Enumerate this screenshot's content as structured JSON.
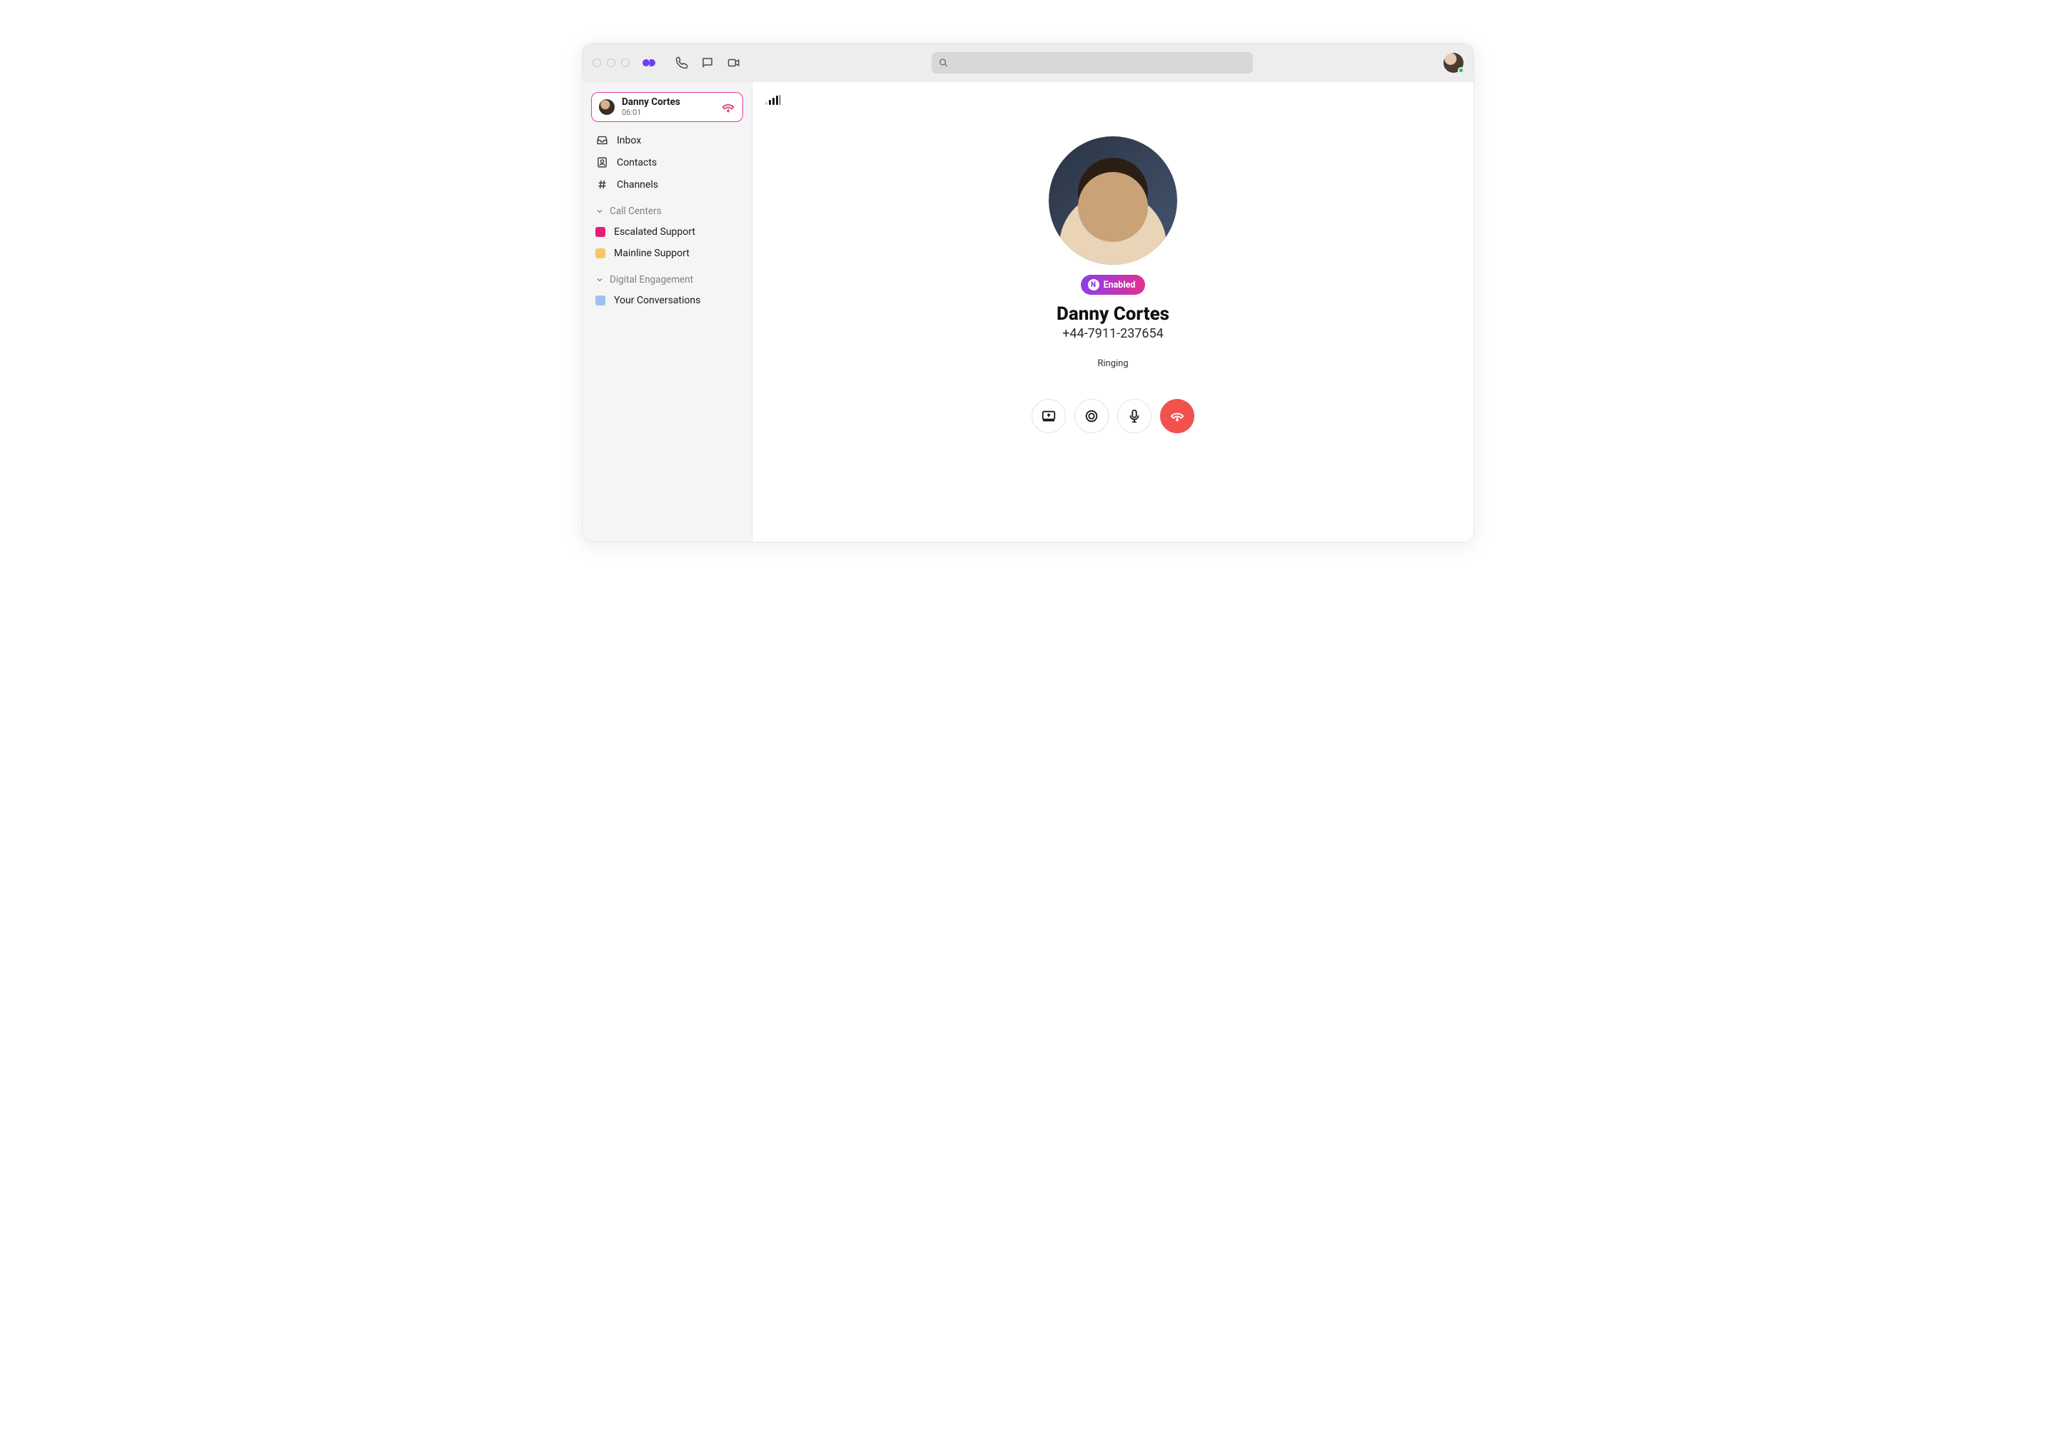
{
  "search": {
    "placeholder": ""
  },
  "active_call_card": {
    "name": "Danny Cortes",
    "duration": "06:01"
  },
  "sidebar": {
    "nav": [
      {
        "label": "Inbox"
      },
      {
        "label": "Contacts"
      },
      {
        "label": "Channels"
      }
    ],
    "sections": {
      "call_centers": {
        "title": "Call Centers",
        "items": [
          {
            "label": "Escalated Support",
            "color": "#e81d76"
          },
          {
            "label": "Mainline Support",
            "color": "#f6c667"
          }
        ]
      },
      "digital_engagement": {
        "title": "Digital Engagement",
        "items": [
          {
            "label": "Your Conversations",
            "color": "#9fc0f2"
          }
        ]
      }
    }
  },
  "call": {
    "enabled_label": "Enabled",
    "name": "Danny Cortes",
    "phone": "+44-7911-237654",
    "status": "Ringing"
  }
}
